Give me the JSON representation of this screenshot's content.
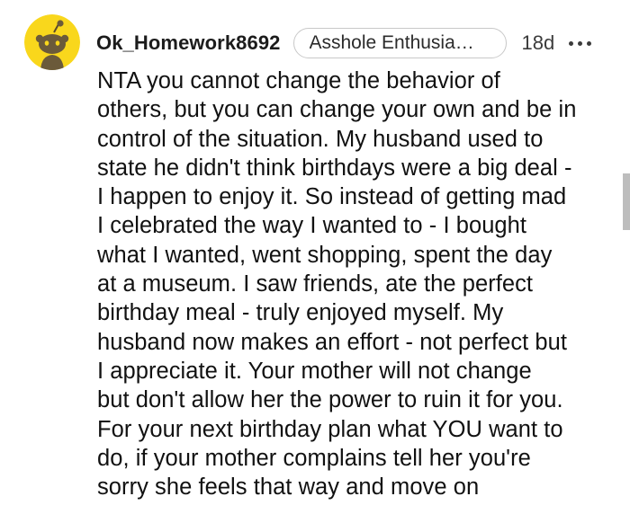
{
  "comment": {
    "username": "Ok_Homework8692",
    "flair": "Asshole Enthusia…",
    "age": "18d",
    "avatar_icon": "snoo-avatar-icon",
    "more_icon": "more-options-icon",
    "accent_color": "#f9d71c",
    "body_lines": [
      "NTA you cannot change the behavior of",
      "others, but you can change your own and be in",
      "control of the situation. My husband used to",
      "state he didn't think birthdays were a big deal -",
      "I happen to enjoy it. So instead of getting mad",
      "I celebrated the way I wanted to - I bought",
      "what I wanted, went shopping, spent the day",
      "at a museum. I saw friends, ate the perfect",
      "birthday meal - truly enjoyed myself. My",
      "husband now makes an effort - not perfect but",
      "I appreciate it. Your mother will not change",
      "but don't allow her the power to ruin it for you.",
      "For your next birthday plan what YOU want to",
      "do, if your mother complains tell her you're",
      "sorry she feels that way and move on"
    ]
  }
}
